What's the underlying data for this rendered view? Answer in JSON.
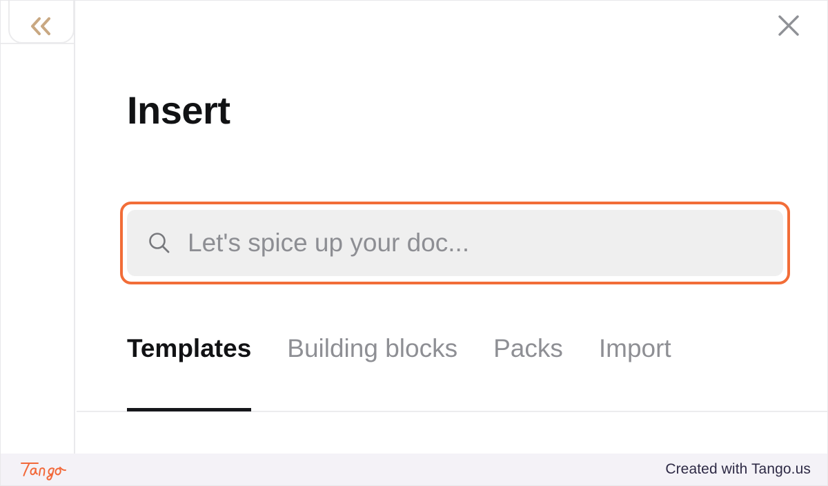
{
  "window": {
    "collapse_button_icon": "double-chevron-left-icon",
    "close_button_icon": "close-icon"
  },
  "panel": {
    "title": "Insert"
  },
  "search": {
    "icon": "search-icon",
    "value": "",
    "placeholder": "Let's spice up your doc...",
    "highlight_color": "#f26d38",
    "field_background": "#efefef"
  },
  "tabs": {
    "active_index": 0,
    "items": [
      {
        "label": "Templates"
      },
      {
        "label": "Building blocks"
      },
      {
        "label": "Packs"
      },
      {
        "label": "Import"
      }
    ]
  },
  "footer": {
    "logo_text": "Tango",
    "note": "Created with Tango.us",
    "brand_color": "#f2693a",
    "background": "#f4f2f7"
  }
}
